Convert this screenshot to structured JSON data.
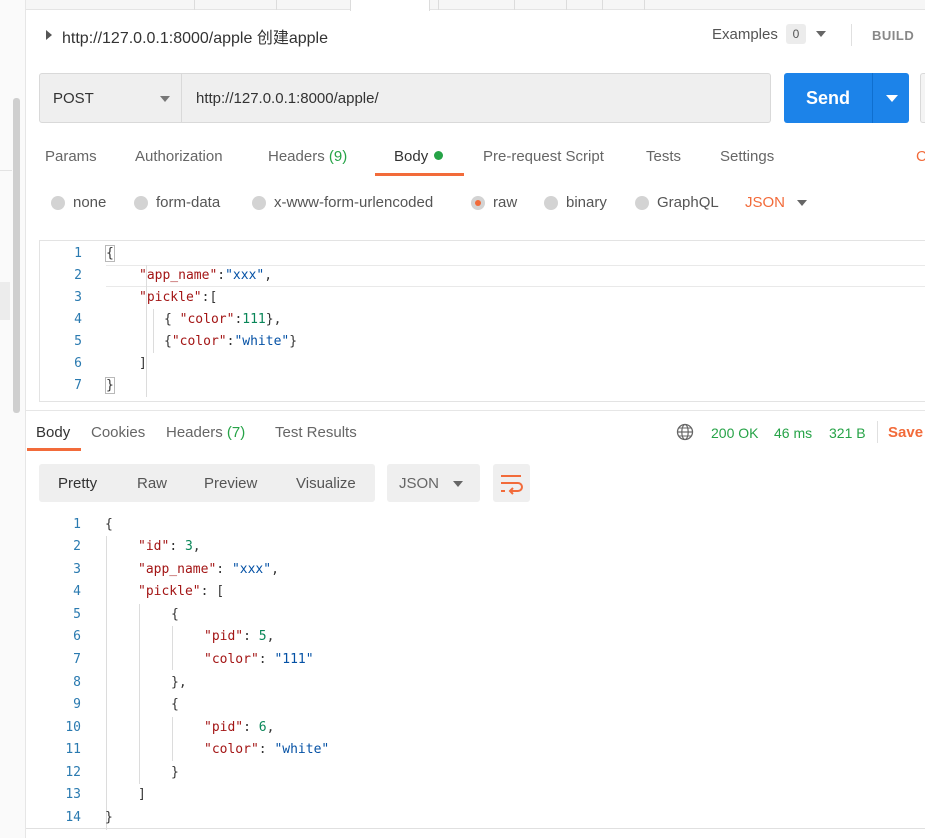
{
  "request": {
    "title": "http://127.0.0.1:8000/apple 创建apple",
    "examples_label": "Examples",
    "examples_count": "0",
    "build_label": "BUILD",
    "method": "POST",
    "url": "http://127.0.0.1:8000/apple/",
    "send_label": "Send"
  },
  "request_tabs": [
    {
      "label": "Params"
    },
    {
      "label": "Authorization"
    },
    {
      "label": "Headers",
      "count": "(9)"
    },
    {
      "label": "Body"
    },
    {
      "label": "Pre-request Script"
    },
    {
      "label": "Tests"
    },
    {
      "label": "Settings"
    },
    {
      "label": "C"
    }
  ],
  "body_types": [
    "none",
    "form-data",
    "x-www-form-urlencoded",
    "raw",
    "binary",
    "GraphQL"
  ],
  "body_type_selected": "raw",
  "body_format": "JSON",
  "request_body_lines": [
    "1",
    "2",
    "3",
    "4",
    "5",
    "6",
    "7"
  ],
  "request_body_text": {
    "l1": "{",
    "l2k": "\"app_name\"",
    "l2c": ":",
    "l2v": "\"xxx\"",
    "l2e": ",",
    "l3k": "\"pickle\"",
    "l3e": ":[",
    "l4a": "{ ",
    "l4k": "\"color\"",
    "l4c": ":",
    "l4v": "111",
    "l4e": "},",
    "l5a": "{",
    "l5k": "\"color\"",
    "l5c": ":",
    "l5v": "\"white\"",
    "l5e": "}",
    "l6": "]",
    "l7": "}"
  },
  "response_tabs": [
    {
      "label": "Body"
    },
    {
      "label": "Cookies"
    },
    {
      "label": "Headers",
      "count": "(7)"
    },
    {
      "label": "Test Results"
    }
  ],
  "response_status": {
    "status": "200 OK",
    "time": "46 ms",
    "size": "321 B",
    "save_label": "Save"
  },
  "response_views": [
    "Pretty",
    "Raw",
    "Preview",
    "Visualize"
  ],
  "response_format": "JSON",
  "response_lines": [
    "1",
    "2",
    "3",
    "4",
    "5",
    "6",
    "7",
    "8",
    "9",
    "10",
    "11",
    "12",
    "13",
    "14"
  ],
  "response_text": {
    "l1": "{",
    "l2k": "\"id\"",
    "l2c": ": ",
    "l2v": "3",
    "l2e": ",",
    "l3k": "\"app_name\"",
    "l3c": ": ",
    "l3v": "\"xxx\"",
    "l3e": ",",
    "l4k": "\"pickle\"",
    "l4e": ": [",
    "l5": "{",
    "l6k": "\"pid\"",
    "l6c": ": ",
    "l6v": "5",
    "l6e": ",",
    "l7k": "\"color\"",
    "l7c": ": ",
    "l7v": "\"111\"",
    "l8": "},",
    "l9": "{",
    "l10k": "\"pid\"",
    "l10c": ": ",
    "l10v": "6",
    "l10e": ",",
    "l11k": "\"color\"",
    "l11c": ": ",
    "l11v": "\"white\"",
    "l12": "}",
    "l13": "]",
    "l14": "}"
  },
  "colors": {
    "accent": "#f26b3a",
    "send": "#1c83e9",
    "success": "#26a347",
    "json_key": "#a31515",
    "json_string": "#0451a5",
    "json_number": "#098658"
  }
}
